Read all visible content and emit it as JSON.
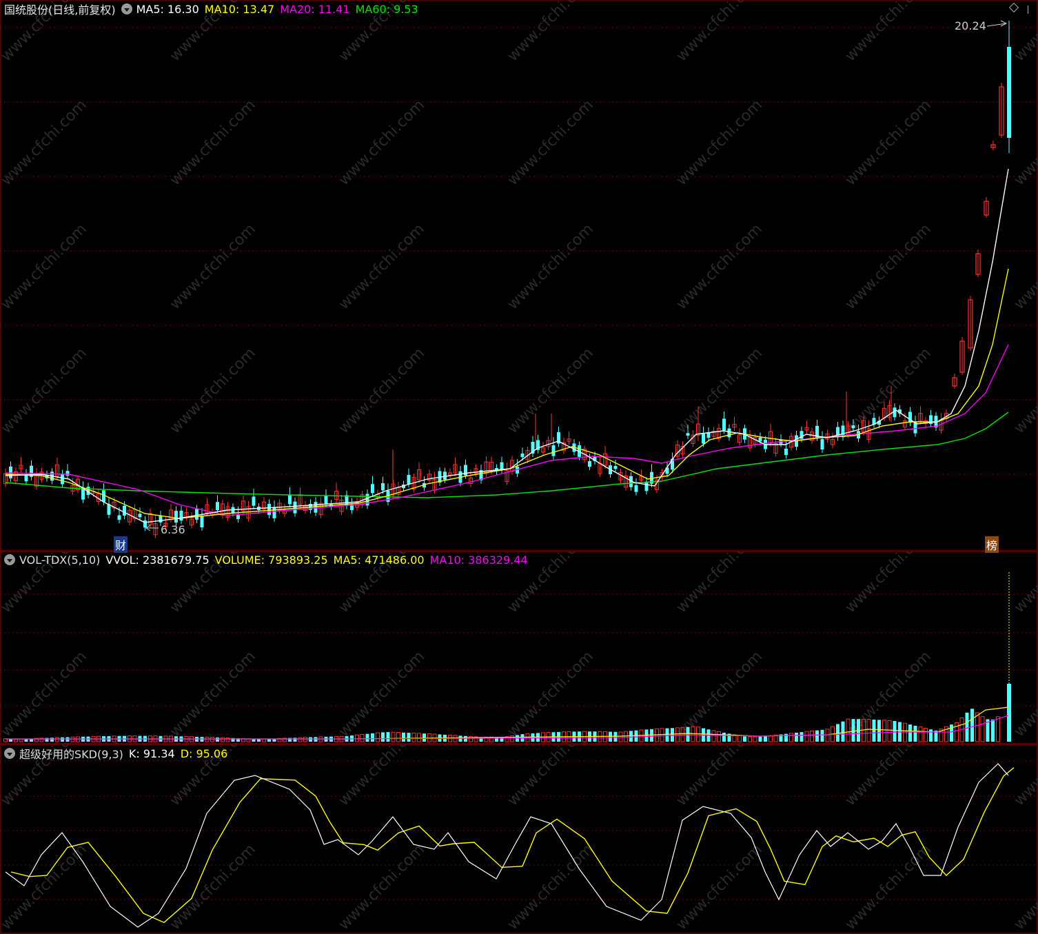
{
  "main": {
    "title": "国统股份(日线,前复权)",
    "ma5": "MA5: 16.30",
    "ma10": "MA10: 13.47",
    "ma20": "MA20: 11.41",
    "ma60": "MA60: 9.53",
    "high_label": "20.24",
    "low_label": "6.36",
    "tag_cai": "财",
    "tag_bang": "榜"
  },
  "volume": {
    "name": "VOL-TDX(5,10)",
    "vvol": "VVOL: 2381679.75",
    "volume": "VOLUME: 793893.25",
    "ma5": "MA5: 471486.00",
    "ma10": "MA10: 386329.44"
  },
  "skd": {
    "name": "超级好用的SKD(9,3)",
    "k": "K: 91.34",
    "d": "D: 95.06"
  },
  "watermark": "www.cfchi.com",
  "colors": {
    "up": "#ff3232",
    "down": "#54ffff",
    "ma5": "#ffffff",
    "ma10": "#ffff00",
    "ma20": "#ff00ff",
    "ma60": "#00e600",
    "grid": "#7a0000"
  }
}
